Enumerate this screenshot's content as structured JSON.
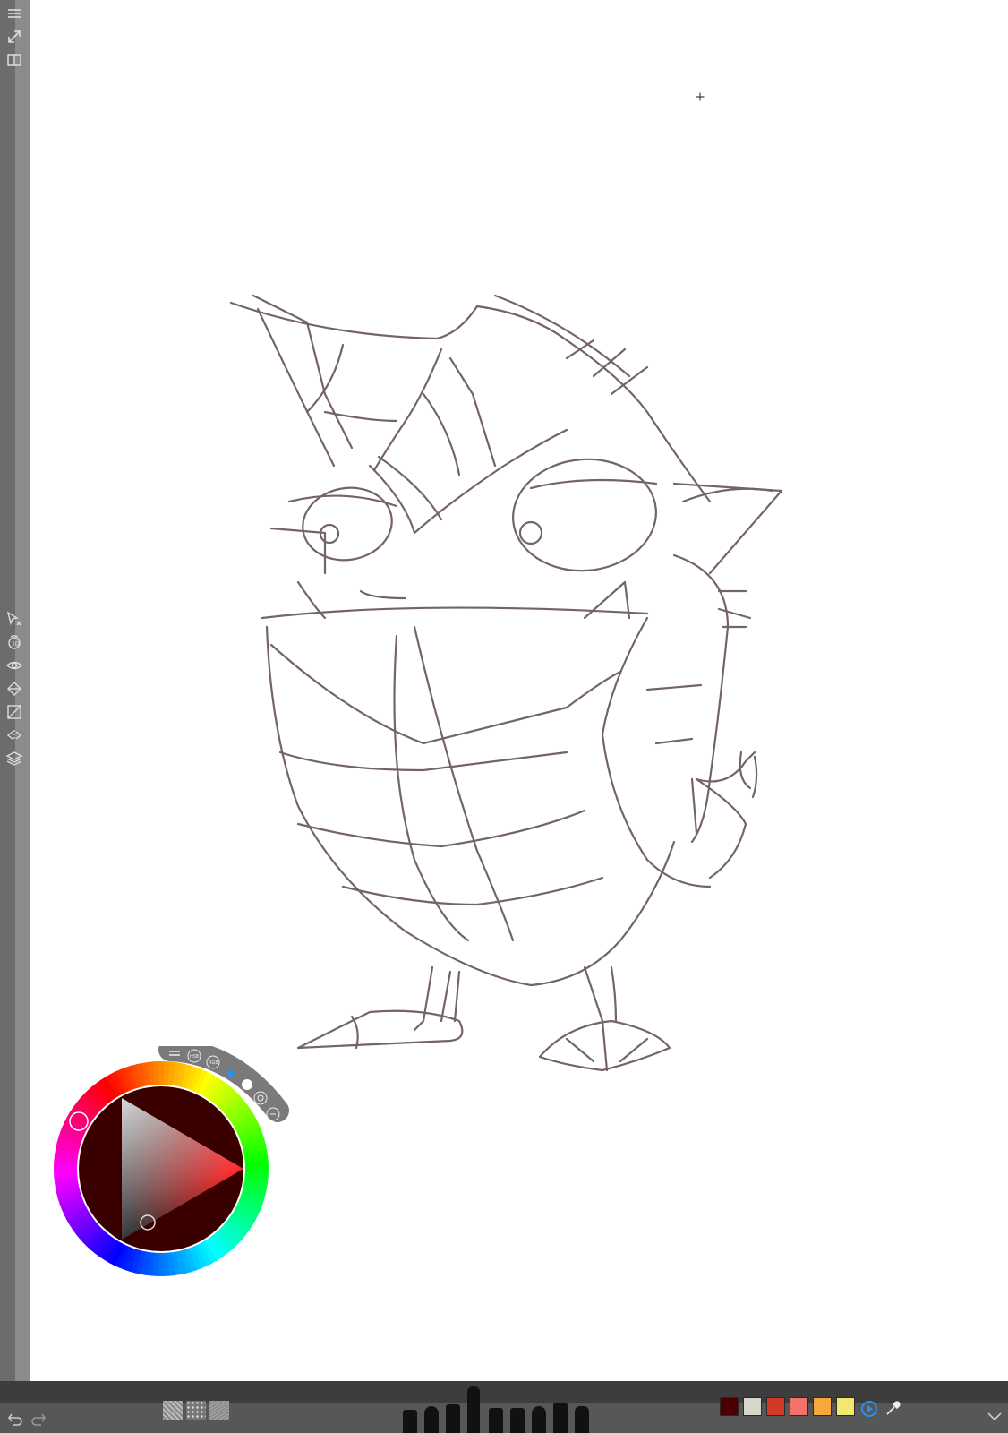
{
  "app": {
    "canvas_background": "#ffffff",
    "sketch_color": "#5a4848"
  },
  "left_toolbar": {
    "top_items": [
      {
        "name": "menu-icon"
      },
      {
        "name": "fullscreen-icon"
      },
      {
        "name": "library-icon"
      }
    ],
    "tool_items": [
      {
        "name": "selection-tool-icon"
      },
      {
        "name": "transform-tool-icon"
      },
      {
        "name": "visibility-icon"
      },
      {
        "name": "fill-tool-icon"
      },
      {
        "name": "ruler-tool-icon"
      },
      {
        "name": "symmetry-tool-icon"
      },
      {
        "name": "layers-icon"
      }
    ]
  },
  "color_puck": {
    "menu_items": [
      {
        "name": "puck-menu-icon",
        "label": ""
      },
      {
        "name": "hsb-mode-button",
        "label": "HSB"
      },
      {
        "name": "rgb-mode-button",
        "label": "RGB"
      },
      {
        "name": "triangle-mode-button",
        "label": ""
      },
      {
        "name": "white-mode-button",
        "label": ""
      },
      {
        "name": "palette-mode-button",
        "label": ""
      },
      {
        "name": "pin-icon",
        "label": ""
      }
    ],
    "current_color": "#3a0000",
    "hue_color": "#ff0000"
  },
  "bottom_bar": {
    "undo": "undo-icon",
    "redo": "redo-icon",
    "textures": [
      "texture-1",
      "texture-2",
      "texture-3"
    ],
    "brushes": [
      "pencil",
      "brush",
      "marker",
      "technical-pen",
      "felt-tip",
      "paintbrush",
      "ink-pen",
      "nib-pen",
      "spray",
      "crayon"
    ],
    "swatches": [
      "#4a0000",
      "#d7d6c9",
      "#d13a27",
      "#f4706a",
      "#f6a83d",
      "#f0e96e"
    ],
    "color_picker_icon": "eyedropper-icon",
    "collapse_icon": "chevron-down-icon"
  }
}
